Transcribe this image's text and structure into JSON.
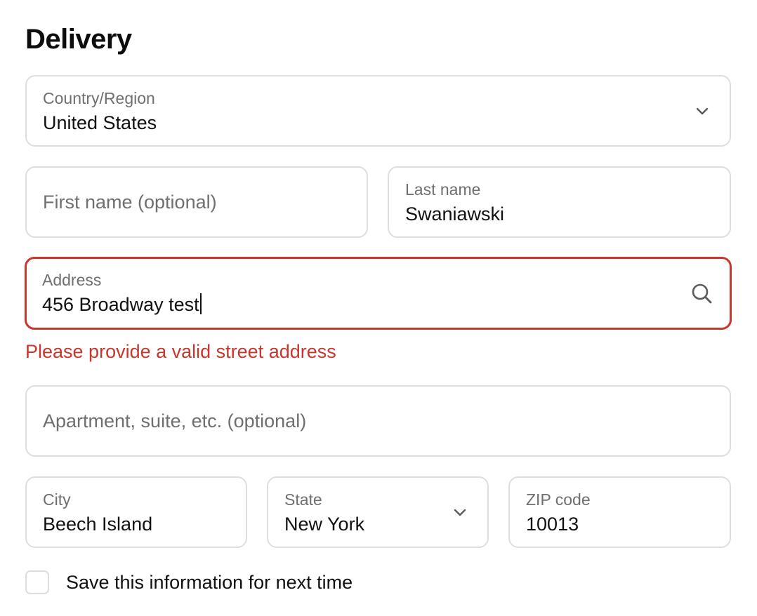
{
  "section": {
    "title": "Delivery"
  },
  "country": {
    "label": "Country/Region",
    "value": "United States"
  },
  "first_name": {
    "placeholder": "First name (optional)"
  },
  "last_name": {
    "label": "Last name",
    "value": "Swaniawski"
  },
  "address": {
    "label": "Address",
    "value": "456 Broadway test",
    "error": "Please provide a valid street address"
  },
  "apartment": {
    "placeholder": "Apartment, suite, etc. (optional)"
  },
  "city": {
    "label": "City",
    "value": "Beech Island"
  },
  "state": {
    "label": "State",
    "value": "New York"
  },
  "zip": {
    "label": "ZIP code",
    "value": "10013"
  },
  "save_info": {
    "label": "Save this information for next time",
    "checked": false
  },
  "icons": {
    "dropdown": "chevron-down-icon",
    "search": "search-icon"
  },
  "colors": {
    "error": "#c8372d",
    "border": "#dedede",
    "label": "#6f6f6f",
    "text": "#111111"
  }
}
